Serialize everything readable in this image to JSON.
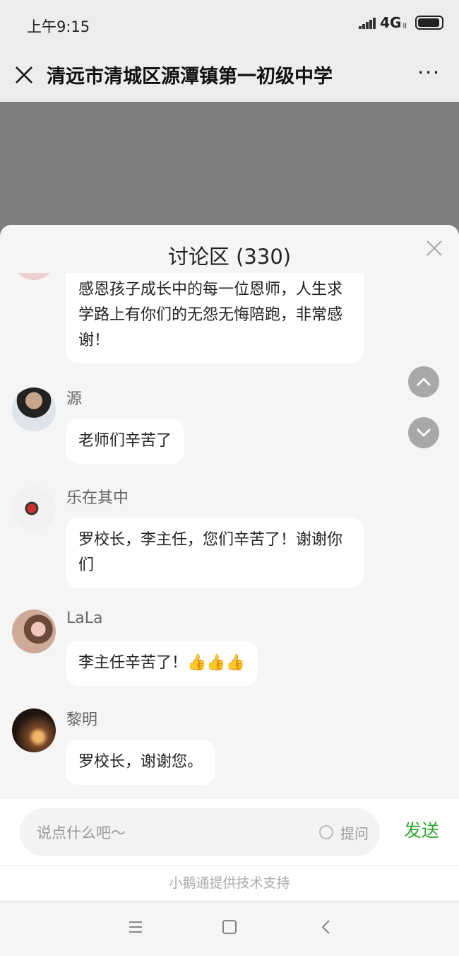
{
  "status_bar": {
    "time": "上午9:15",
    "network": "4G",
    "network_sub": "ll"
  },
  "nav": {
    "title": "清远市清城区源潭镇第一初级中学",
    "more": "···"
  },
  "panel": {
    "title": "讨论区 (330)"
  },
  "messages": [
    {
      "name": "",
      "text": "感恩孩子成长中的每一位恩师，人生求学路上有你们的无怨无悔陪跑，非常感谢！"
    },
    {
      "name": "源",
      "text": "老师们辛苦了"
    },
    {
      "name": "乐在其中",
      "text": "罗校长，李主任，您们辛苦了！谢谢你们"
    },
    {
      "name": "LaLa",
      "text": "李主任辛苦了！👍👍👍"
    },
    {
      "name": "黎明",
      "text": "罗校长，谢谢您。"
    }
  ],
  "input": {
    "placeholder": "说点什么吧～",
    "ask_label": "提问",
    "send_label": "发送"
  },
  "footer": {
    "tech_support": "小鹅通提供技术支持"
  },
  "icons": {
    "nav_close": "close-icon",
    "panel_close": "close-icon",
    "scroll_up": "chevron-up-icon",
    "scroll_down": "chevron-down-icon",
    "menu": "menu-icon",
    "home": "home-icon",
    "back": "back-icon"
  },
  "colors": {
    "send": "#2ea82e",
    "overlay": "#7f7f7f",
    "bubble": "#ffffff"
  }
}
